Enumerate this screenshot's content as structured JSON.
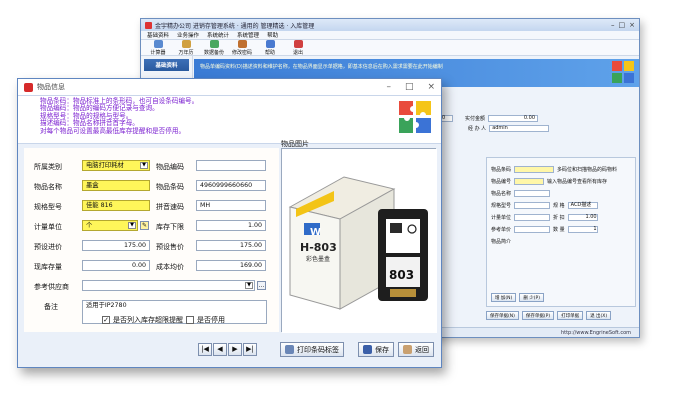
{
  "bg_window": {
    "title": "金宇精办公司 进销存管理系统 · 通用的 管理精选 · 入库管理",
    "menu": [
      "基础资料",
      "业务操作",
      "系统统计",
      "系统管理",
      "帮助"
    ],
    "toolbar": [
      "计算器",
      "万年历",
      "数据备份",
      "修改密码",
      "帮助",
      "退出"
    ],
    "nav_header": "基础资料",
    "banner_text": "物品单编码资料(D)描述资料和维护名称，在物品界面显示单据格，即基本信息后在购入需求需要在此开始编制",
    "field_labels": [
      "实付金额",
      "经 办 人"
    ],
    "field_values": [
      "0.00",
      "admin"
    ],
    "rp_labels": [
      "物品条码",
      "物品编号",
      "物品名称",
      "规格型号",
      "计量单位",
      "参考单价",
      "物品简介"
    ],
    "rp_hints": [
      "多码位和扫描物品的码物料",
      "输入物品编号查看所有库存"
    ],
    "rp_labels2": [
      "数",
      "规 格",
      "折 扣",
      "数 量"
    ],
    "rp_values2": [
      "ACD描述",
      "1.00",
      "1"
    ],
    "rp_btns": [
      "增 加(N)",
      "删 少(P)"
    ],
    "bottom_btns": [
      "保存单据(N)",
      "保存单据(P)",
      "打印单据",
      "退 出(X)"
    ],
    "status": "http://www.EngrineSoft.com"
  },
  "dialog": {
    "title": "物品信息",
    "header_lines": [
      "物品条码：物品标准上的条形码，也可自设条码编号。",
      "物品编码：物品的编码方便记录与查询。",
      "规格型号：物品的规格与型号。",
      "描述编码：物品名称拼音首字母。",
      "对每个物品可设置最高最低库存提醒和是否停用。"
    ],
    "labels": {
      "category": "所属类别",
      "item_code": "物品编码",
      "item_name": "物品名称",
      "barcode": "物品条码",
      "spec": "规格型号",
      "pinyin": "拼音速码",
      "unit": "计量单位",
      "stock_min": "库存下限",
      "pre_buy": "预设进价",
      "pre_sell": "预设售价",
      "stock_now": "现库存量",
      "avg_cost": "成本均价",
      "supplier": "参考供应商",
      "remark": "备注",
      "image": "物品图片"
    },
    "values": {
      "category": "电脑打印耗材",
      "item_code": "",
      "item_name": "墨盒",
      "barcode": "4960999660660",
      "spec": "佳能 816",
      "pinyin": "MH",
      "unit": "个",
      "stock_min": "1.00",
      "pre_buy": "175.00",
      "pre_sell": "175.00",
      "stock_now": "0.00",
      "avg_cost": "169.00",
      "supplier": "",
      "remark": "适用于IP2780"
    },
    "checkboxes": [
      {
        "label": "是否列入库存超限提醒",
        "checked": true
      },
      {
        "label": "是否停用",
        "checked": false
      }
    ],
    "nav_buttons": [
      "|◀",
      "◀",
      "▶",
      "▶|"
    ],
    "buttons": {
      "print": "打印条码标签",
      "save": "保存",
      "back": "返回"
    },
    "product_box": {
      "model": "H-803",
      "subtitle": "彩色墨盒",
      "brand": "W",
      "cart_label": "803"
    }
  },
  "colors": {
    "header_text": "#7a1fd0",
    "required_field": "#fff65a",
    "banner": "#3a7bd5"
  }
}
